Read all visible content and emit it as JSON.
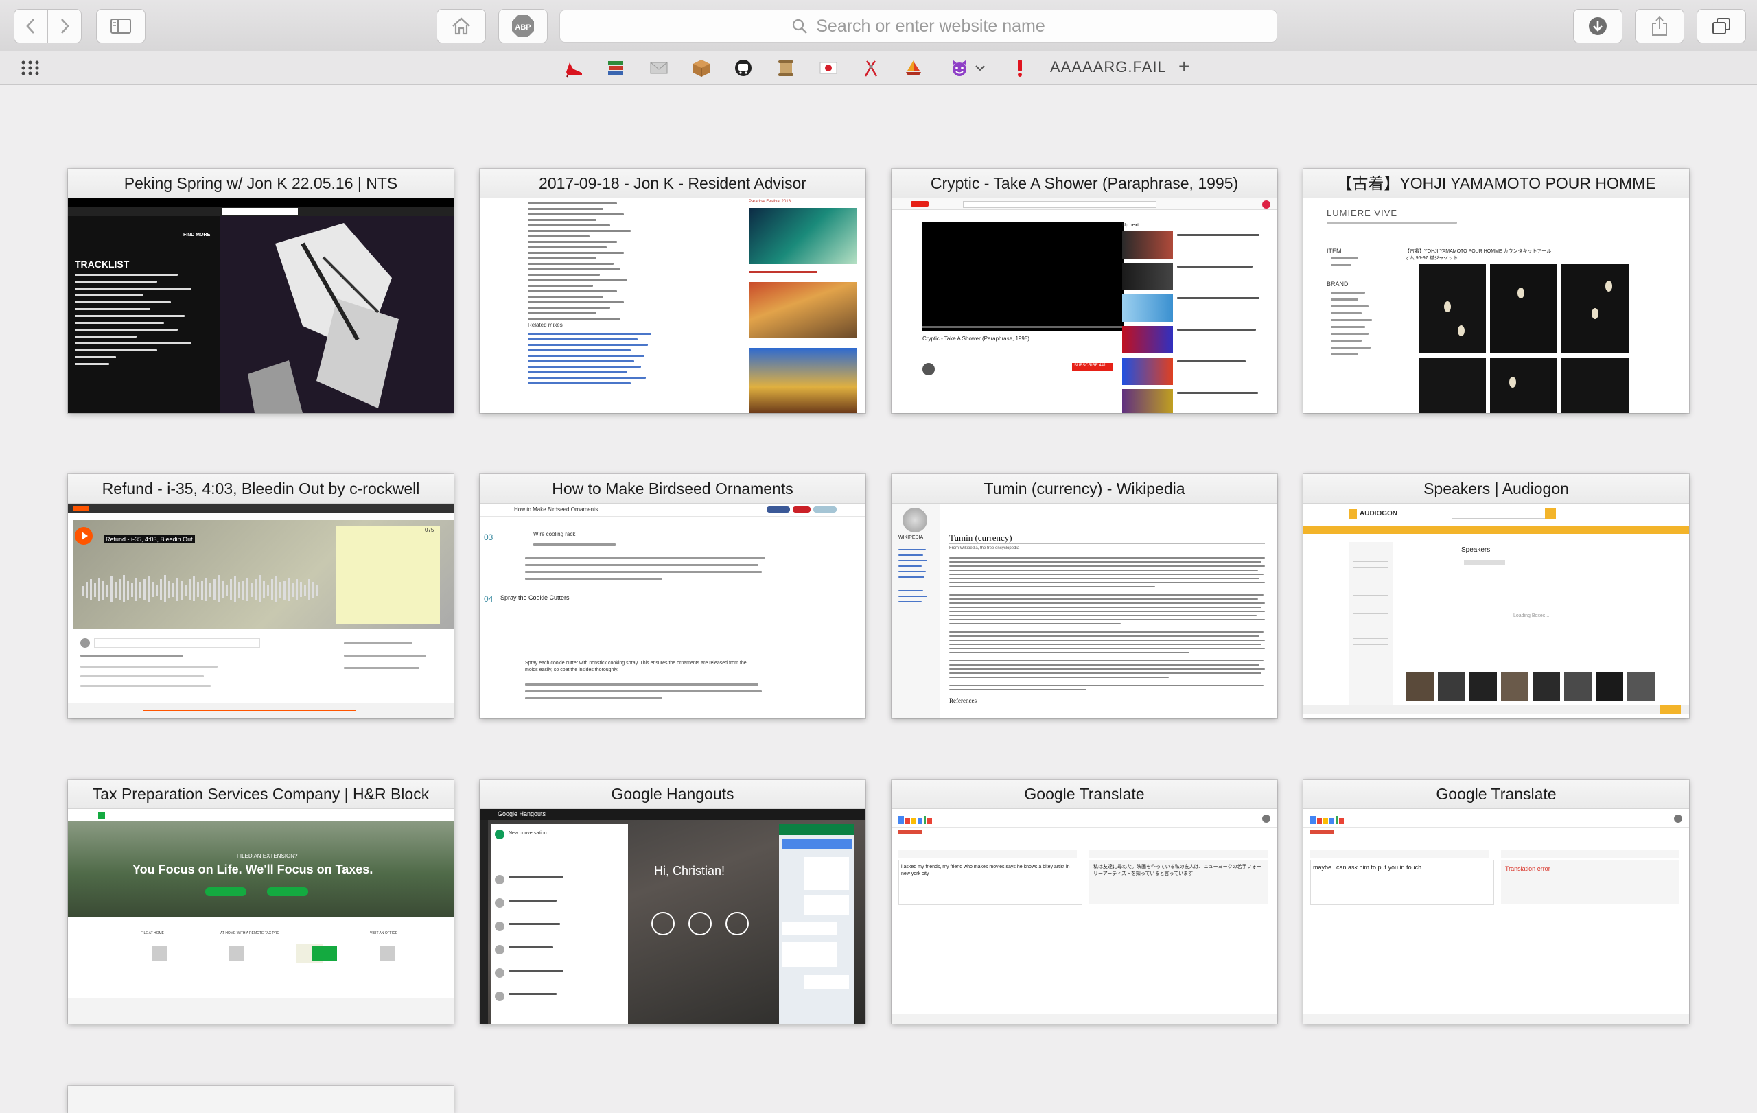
{
  "toolbar": {
    "address_placeholder": "Search or enter website name"
  },
  "favorites_bar": {
    "icons": [
      "shoe-icon",
      "books-icon",
      "envelope-icon",
      "package-icon",
      "subway-icon",
      "scroll-icon",
      "flag-japan-icon",
      "ribbon-icon",
      "sailboat-icon",
      "devil-icon",
      "exclamation-icon"
    ],
    "text_bookmark": "AAAAARG.FAIL",
    "add_label": "+"
  },
  "tabs": [
    {
      "title": "Peking Spring w/ Jon K 22.05.16 | NTS"
    },
    {
      "title": "2017-09-18 - Jon K - Resident Advisor"
    },
    {
      "title": "Cryptic - Take A Shower (Paraphrase, 1995)"
    },
    {
      "title": "【古着】YOHJI YAMAMOTO POUR HOMME"
    },
    {
      "title": "Refund - i-35, 4:03, Bleedin Out by c-rockwell"
    },
    {
      "title": "How to Make Birdseed Ornaments"
    },
    {
      "title": "Tumin (currency) - Wikipedia"
    },
    {
      "title": "Speakers | Audiogon"
    },
    {
      "title": "Tax Preparation Services Company | H&R Block"
    },
    {
      "title": "Google Hangouts"
    },
    {
      "title": "Google Translate"
    },
    {
      "title": "Google Translate"
    }
  ],
  "thumbs": {
    "nts": {
      "heading": "TRACKLIST",
      "button": "FIND MORE"
    },
    "ra": {
      "related": "Related mixes",
      "festival": "Paradise Festival 2018"
    },
    "yt": {
      "video_title": "Cryptic - Take A Shower (Paraphrase, 1995)",
      "subscribe": "SUBSCRIBE 441",
      "up_next": "Up next"
    },
    "yohji": {
      "brand": "LUMIERE VIVE",
      "item_label": "ITEM",
      "brand_label": "BRAND",
      "title": "【古着】YOHJI YAMAMOTO POUR HOMME カウンタキットアールオム 96-97 襟ジャケット"
    },
    "sc": {
      "track": "Refund - i-35, 4:03, Bleedin Out",
      "count": "075"
    },
    "spruce": {
      "heading": "How to Make Birdseed Ornaments",
      "step3": "Wire cooling rack",
      "step4": "Spray the Cookie Cutters",
      "step4_num": "04",
      "step3_num": "03",
      "body": "Spray each cookie cutter with nonstick cooking spray. This ensures the ornaments are released from the molds easily, so coat the insides thoroughly."
    },
    "wiki": {
      "title": "Tumin (currency)",
      "subtitle": "From Wikipedia, the free encyclopedia",
      "logo": "WIKIPEDIA",
      "references": "References"
    },
    "audiogon": {
      "logo": "AUDIOGON",
      "heading": "Speakers",
      "loading": "Loading Boxes..."
    },
    "hrb": {
      "banner": "FILED AN EXTENSION?",
      "headline": "You Focus on Life. We'll Focus on Taxes.",
      "col1": "FILE AT HOME",
      "col2": "AT HOME WITH A REMOTE TAX PRO",
      "col3": "FILE WITH A TAX PRO",
      "col4": "VISIT AN OFFICE"
    },
    "hangouts": {
      "app": "Google Hangouts",
      "greeting": "Hi, Christian!",
      "new_convo": "New conversation"
    },
    "gt1": {
      "source": "i asked my friends, my friend who makes movies says he knows a bitey artist in new york city",
      "target": "私は友達に尋ねた。映画を作っている私の友人は、ニューヨークの若手フォーリーアーティストを知っていると言っています"
    },
    "gt2": {
      "source": "maybe i can ask him to put you in touch",
      "target": "Translation error"
    }
  }
}
